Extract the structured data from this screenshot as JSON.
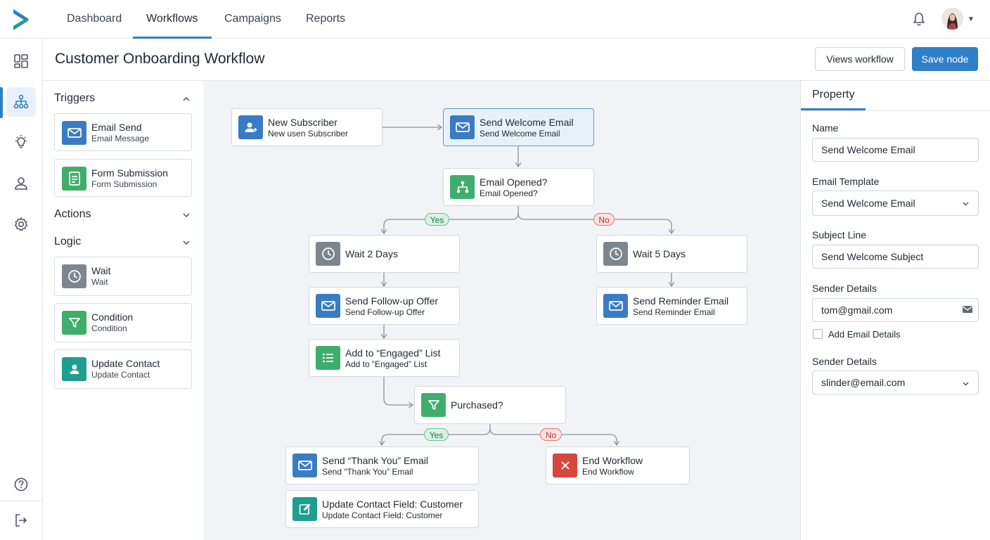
{
  "nav": {
    "tabs": [
      {
        "label": "Dashboard"
      },
      {
        "label": "Workflows"
      },
      {
        "label": "Campaigns"
      },
      {
        "label": "Reports"
      }
    ],
    "active_tab": "Workflows"
  },
  "header": {
    "title": "Customer Onboarding Workflow",
    "view_button": "Views workflow",
    "save_button": "Save node"
  },
  "sidebar": {
    "sections": {
      "triggers": "Triggers",
      "actions": "Actions",
      "logic": "Logic"
    },
    "trigger_items": [
      {
        "title": "Email Send",
        "subtitle": "Email Message",
        "icon": "mail-icon"
      },
      {
        "title": "Form Submission",
        "subtitle": "Form Submission",
        "icon": "form-icon"
      }
    ],
    "logic_items": [
      {
        "title": "Wait",
        "subtitle": "Wait",
        "icon": "clock-icon"
      },
      {
        "title": "Condition",
        "subtitle": "Condition",
        "icon": "filter-icon"
      },
      {
        "title": "Update Contact",
        "subtitle": "Update Contact",
        "icon": "person-icon"
      }
    ]
  },
  "canvas": {
    "nodes": {
      "new_subscriber": {
        "title": "New Subscriber",
        "subtitle": "New usen Subscriber"
      },
      "send_welcome": {
        "title": "Send Welcome Email",
        "subtitle": "Send Welcome Email"
      },
      "email_opened": {
        "title": "Email Opened?",
        "subtitle": "Email Opened?"
      },
      "wait_2": {
        "title": "Wait 2 Days"
      },
      "wait_5": {
        "title": "Wait 5 Days"
      },
      "followup": {
        "title": "Send Follow-up Offer",
        "subtitle": "Send Follow-up Offer"
      },
      "reminder": {
        "title": "Send Reminder Email",
        "subtitle": "Send Reminder Email"
      },
      "engaged": {
        "title": "Add to “Engaged” List",
        "subtitle": "Add to “Engaged” List"
      },
      "purchased": {
        "title": "Purchased?"
      },
      "thankyou": {
        "title": "Send “Thank You” Email",
        "subtitle": "Send “Thank You” Email"
      },
      "end": {
        "title": "End Workflow",
        "subtitle": "End Workflow"
      },
      "update_field": {
        "title": "Update Contact Field: Customer",
        "subtitle": "Update Contact Field: Customer"
      }
    },
    "badges": {
      "yes": "Yes",
      "no": "No"
    }
  },
  "property": {
    "tab": "Property",
    "name_label": "Name",
    "name_value": "Send Welcome Email",
    "template_label": "Email Template",
    "template_value": "Send Welcome Email",
    "subject_label": "Subject Line",
    "subject_value": "Send Welcome Subject",
    "sender_label": "Sender Details",
    "sender_value": "tom@gmail.com",
    "add_details_label": "Add Email Details",
    "sender2_label": "Sender Details",
    "sender2_value": "slinder@email.com"
  },
  "colors": {
    "accent": "#2f7fc6",
    "icon_blue": "#3a7cc3",
    "icon_green": "#3fae6a",
    "icon_gray": "#7d868f",
    "icon_red": "#d9453f",
    "yes_badge": "#d9f1e4",
    "no_badge": "#fbe1e1"
  }
}
